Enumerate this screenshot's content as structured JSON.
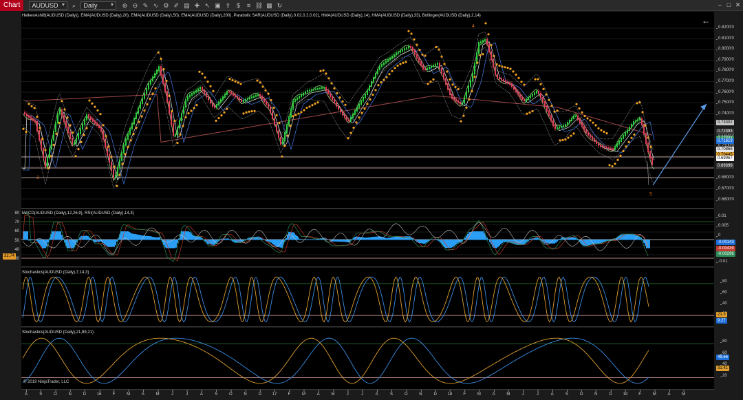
{
  "toolbar": {
    "title": "Chart",
    "instrument": "AUDUSD",
    "interval": "Daily"
  },
  "panels": {
    "price": {
      "label": "HeikenAshi8(AUDUSD (Daily)), EMA(AUDUSD (Daily),20), EMA(AUDUSD (Daily),50), EMA(AUDUSD (Daily),200), Parabolic SAR(AUDUSD (Daily),0.02,0.2,0.02), HMA(AUDUSD (Daily),14), HMA(AUDUSD (Daily),33), Bollinger(AUDUSD (Daily),2,14)",
      "ticks": [
        "0.8200'0",
        "0.8100'0",
        "0.8000'0",
        "0.7900'0",
        "0.7800'0",
        "0.7700'0",
        "0.7600'0",
        "0.7500'0",
        "0.7400'0",
        "0.7300'0",
        "0.7200'0",
        "0.7100'0",
        "0.7000'0",
        "0.6900'0",
        "0.6800'0",
        "0.6700'0",
        "0.6600'0"
      ],
      "flags": [
        {
          "text": "0.73302",
          "color": "#c8c8c8",
          "fg": "#000"
        },
        {
          "text": "0.72393",
          "color": "#3a3a3a",
          "fg": "#fff"
        },
        {
          "text": "0.72333",
          "color": "#2e8b57",
          "fg": "#fff"
        },
        {
          "text": "0.71619",
          "color": "#1e6fd9",
          "fg": "#fff"
        },
        {
          "text": "0.70866",
          "color": "#e6e6e6",
          "fg": "#000"
        },
        {
          "text": "0.70445",
          "color": "#e0a030",
          "fg": "#000"
        },
        {
          "text": "0.69967",
          "color": "#ffffff",
          "fg": "#000"
        },
        {
          "text": "0.69399",
          "color": "#3a3a3a",
          "fg": "#fff"
        }
      ],
      "wave_labels": [
        "3",
        "4",
        "5"
      ]
    },
    "macd_rsi": {
      "label": "MACD(AUDUSD (Daily),12,26,9), RSI(AUDUSD (Daily),14,3)",
      "left_ticks": [
        "80",
        "70",
        "60",
        "50",
        "40",
        "30"
      ],
      "right_ticks": [
        "0.01",
        "0.005",
        "0",
        "-0.005",
        "-0.01"
      ],
      "left_flag": "32.74",
      "flags": [
        {
          "text": "-0.00143",
          "color": "#1e6fd9",
          "fg": "#fff"
        },
        {
          "text": "-0.00439",
          "color": "#c0392b",
          "fg": "#fff"
        },
        {
          "text": "-0.00296",
          "color": "#2e8b57",
          "fg": "#fff"
        }
      ]
    },
    "stoch1": {
      "label": "Stochastics(AUDUSD (Daily),7,14,3)",
      "ticks": [
        "80",
        "60",
        "40",
        "20"
      ],
      "flags": [
        {
          "text": "21.3",
          "color": "#e0a030",
          "fg": "#000"
        },
        {
          "text": "9.27",
          "color": "#1e6fd9",
          "fg": "#fff"
        }
      ]
    },
    "stoch2": {
      "label": "Stochastics(AUDUSD (Daily),21,89,21)",
      "ticks": [
        "80",
        "60",
        "40",
        "20"
      ],
      "flags": [
        {
          "text": "48.66",
          "color": "#1e6fd9",
          "fg": "#fff"
        },
        {
          "text": "31.41",
          "color": "#e0a030",
          "fg": "#000"
        }
      ],
      "copyright": "© 2019 NinjaTrader, LLC"
    }
  },
  "xaxis": [
    "A",
    "S",
    "O",
    "N",
    "D",
    "16",
    "F",
    "M",
    "A",
    "M",
    "J",
    "J",
    "A",
    "S",
    "O",
    "N",
    "D",
    "17",
    "F",
    "M",
    "A",
    "M",
    "J",
    "J",
    "A",
    "S",
    "O",
    "N",
    "D",
    "18",
    "F",
    "M",
    "A",
    "M",
    "J",
    "J",
    "A",
    "S",
    "O",
    "N",
    "D",
    "19",
    "F",
    "M",
    "A",
    "M"
  ],
  "colors": {
    "ha_up": "#2ecc40",
    "ha_down": "#e0405a",
    "sar": "#f0a020",
    "ema200": "#a04848",
    "macd_hist": "#2a9df4",
    "stoch_k": "#e0a030",
    "stoch_d": "#3a8ee6"
  }
}
